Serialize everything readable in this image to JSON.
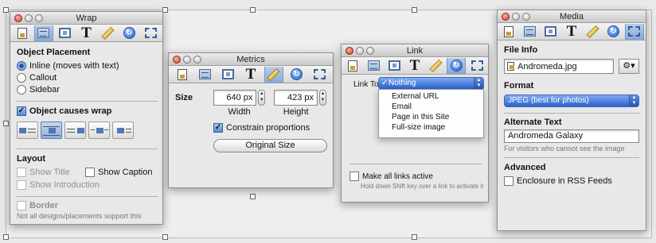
{
  "wrap_panel": {
    "title": "Wrap",
    "object_placement_label": "Object Placement",
    "placement_options": [
      "Inline (moves with text)",
      "Callout",
      "Sidebar"
    ],
    "selected_placement": "Inline (moves with text)",
    "causes_wrap_label": "Object causes wrap",
    "causes_wrap_checked": true,
    "layout_label": "Layout",
    "show_title_label": "Show Title",
    "show_caption_label": "Show Caption",
    "show_introduction_label": "Show Introduction",
    "border_label": "Border",
    "footnote": "Not all designs/placements support this"
  },
  "metrics_panel": {
    "title": "Metrics",
    "size_label": "Size",
    "width_value": "640 px",
    "height_value": "423 px",
    "width_label": "Width",
    "height_label": "Height",
    "constrain_label": "Constrain proportions",
    "constrain_checked": true,
    "original_size_label": "Original Size"
  },
  "link_panel": {
    "title": "Link",
    "link_to_label": "Link To:",
    "link_options": [
      "Nothing",
      "External URL",
      "Email",
      "Page in this Site",
      "Full-size image"
    ],
    "selected_option": "Nothing",
    "checkmark": "✓",
    "make_active_label": "Make all links active",
    "hint": "Hold down Shift key over a link to activate it"
  },
  "media_panel": {
    "title": "Media",
    "file_info_label": "File Info",
    "file_name": "Andromeda.jpg",
    "format_label": "Format",
    "format_value": "JPEG (best for photos)",
    "alt_text_label": "Alternate Text",
    "alt_text_value": "Andromeda Galaxy",
    "alt_text_hint": "For visitors who cannot see the image",
    "advanced_label": "Advanced",
    "enclosure_label": "Enclosure in RSS Feeds"
  },
  "toolbar_icons": [
    "document-icon",
    "layout-icon",
    "frame-icon",
    "text-icon",
    "ruler-icon",
    "link-icon",
    "crop-icon"
  ],
  "colors": {
    "selection_blue": "#2c63cd",
    "panel_bg": "#e8e8e8"
  }
}
